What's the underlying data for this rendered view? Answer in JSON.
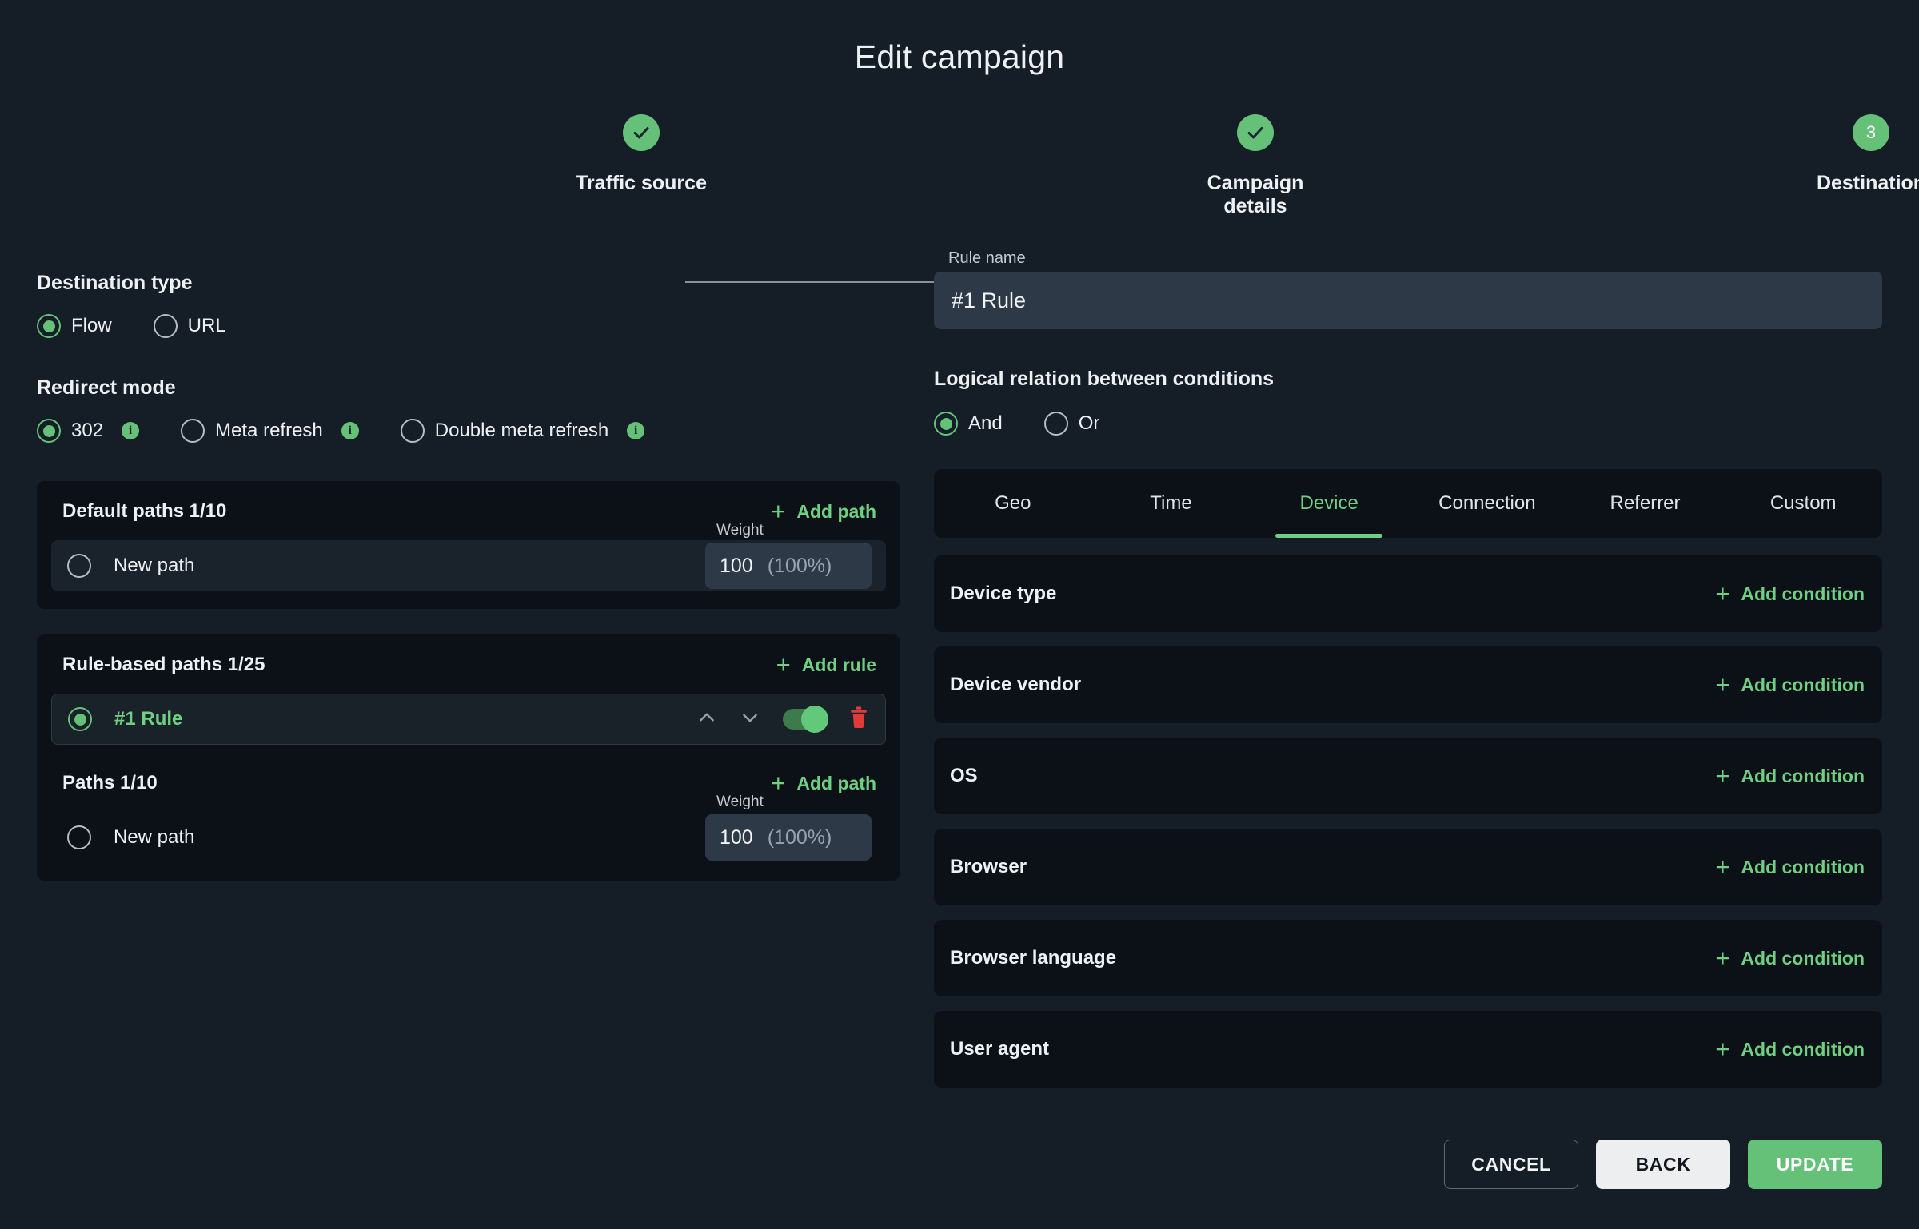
{
  "header": {
    "title": "Edit campaign"
  },
  "stepper": {
    "steps": [
      {
        "label": "Traffic source",
        "state": "complete",
        "marker": "check"
      },
      {
        "label": "Campaign details",
        "state": "complete",
        "marker": "check"
      },
      {
        "label": "Destination",
        "state": "current",
        "marker": "3"
      }
    ],
    "accent_color": "#65c178"
  },
  "left": {
    "destination_type": {
      "heading": "Destination type",
      "options": [
        {
          "label": "Flow",
          "selected": true
        },
        {
          "label": "URL",
          "selected": false
        }
      ]
    },
    "redirect_mode": {
      "heading": "Redirect mode",
      "options": [
        {
          "label": "302",
          "selected": true,
          "info": "i"
        },
        {
          "label": "Meta refresh",
          "selected": false,
          "info": "i"
        },
        {
          "label": "Double meta refresh",
          "selected": false,
          "info": "i"
        }
      ]
    },
    "default_paths": {
      "title": "Default paths 1/10",
      "add_label": "Add path",
      "rows": [
        {
          "label": "New path",
          "selected": false,
          "weight_legend": "Weight",
          "weight_value": "100",
          "weight_percent": "(100%)"
        }
      ]
    },
    "rule_based_paths": {
      "title": "Rule-based paths 1/25",
      "add_label": "Add rule",
      "rule": {
        "label": "#1 Rule",
        "selected": true,
        "toggle_on": true,
        "move_up_icon": "chevron-up-icon",
        "move_down_icon": "chevron-down-icon",
        "delete_icon": "trash-icon"
      },
      "paths": {
        "title": "Paths 1/10",
        "add_label": "Add path",
        "rows": [
          {
            "label": "New path",
            "selected": false,
            "weight_legend": "Weight",
            "weight_value": "100",
            "weight_percent": "(100%)"
          }
        ]
      }
    }
  },
  "right": {
    "rule_name": {
      "legend": "Rule name",
      "value": "#1 Rule",
      "placeholder": "Rule name"
    },
    "logical_relation": {
      "heading": "Logical relation between conditions",
      "options": [
        {
          "label": "And",
          "selected": true
        },
        {
          "label": "Or",
          "selected": false
        }
      ]
    },
    "tabs": [
      {
        "label": "Geo",
        "active": false
      },
      {
        "label": "Time",
        "active": false
      },
      {
        "label": "Device",
        "active": true
      },
      {
        "label": "Connection",
        "active": false
      },
      {
        "label": "Referrer",
        "active": false
      },
      {
        "label": "Custom",
        "active": false
      }
    ],
    "conditions": [
      {
        "label": "Device type",
        "add_label": "Add condition"
      },
      {
        "label": "Device vendor",
        "add_label": "Add condition"
      },
      {
        "label": "OS",
        "add_label": "Add condition"
      },
      {
        "label": "Browser",
        "add_label": "Add condition"
      },
      {
        "label": "Browser language",
        "add_label": "Add condition"
      },
      {
        "label": "User agent",
        "add_label": "Add condition"
      }
    ]
  },
  "footer": {
    "cancel": "CANCEL",
    "back": "BACK",
    "update": "UPDATE"
  }
}
